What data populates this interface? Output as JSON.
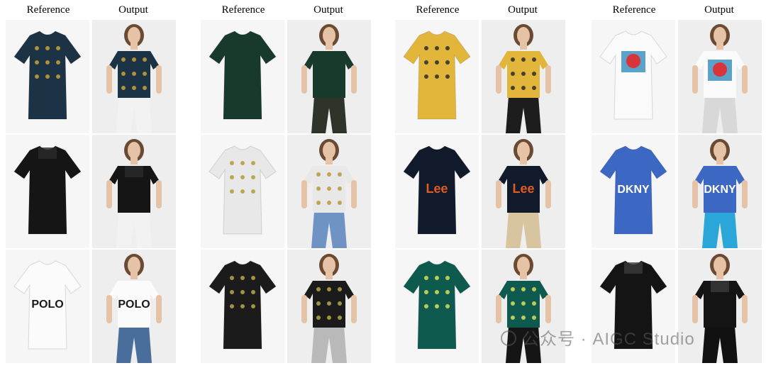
{
  "groups": [
    {
      "reference_header": "Reference",
      "output_header": "Output",
      "rows": [
        {
          "garment": "floral-blouse",
          "color": "#1b3345",
          "accent": "#c9a23a",
          "output_bottom": "#f2f2f2"
        },
        {
          "garment": "lace-top",
          "color": "#151515",
          "accent": "#2a2a2a",
          "output_bottom": "#f2f2f2"
        },
        {
          "garment": "polo-tee",
          "color": "#fbfbfb",
          "accent": "#1a1a1a",
          "print": "POLO",
          "output_bottom": "#4a6e9c"
        }
      ]
    },
    {
      "reference_header": "Reference",
      "output_header": "Output",
      "rows": [
        {
          "garment": "bodysuit",
          "color": "#173a2c",
          "accent": "#173a2c",
          "output_bottom": "#2e3429"
        },
        {
          "garment": "graphic-tee",
          "color": "#e8e8e8",
          "accent": "#b79a3b",
          "output_bottom": "#6f93c4"
        },
        {
          "garment": "floral-tee",
          "color": "#1b1b1b",
          "accent": "#b8a948",
          "output_bottom": "#b9b9b9"
        }
      ]
    },
    {
      "reference_header": "Reference",
      "output_header": "Output",
      "rows": [
        {
          "garment": "yellow-floral",
          "color": "#e2b63a",
          "accent": "#2c2c2c",
          "output_bottom": "#1d1d1d"
        },
        {
          "garment": "lee-tee",
          "color": "#111a2b",
          "accent": "#e25a22",
          "print": "Lee",
          "output_bottom": "#d9c4a0"
        },
        {
          "garment": "green-blouse",
          "color": "#0f5a4f",
          "accent": "#d8e05a",
          "output_bottom": "#151515"
        }
      ]
    },
    {
      "reference_header": "Reference",
      "output_header": "Output",
      "rows": [
        {
          "garment": "rose-tee",
          "color": "#fafafa",
          "accent": "#d8343a",
          "output_bottom": "#d8d8d8"
        },
        {
          "garment": "dkny-tee",
          "color": "#3c67c2",
          "accent": "#ffffff",
          "print": "DKNY",
          "output_bottom": "#2aa7d8"
        },
        {
          "garment": "lace-sweater",
          "color": "#141414",
          "accent": "#3a3a3a",
          "output_bottom": "#111111"
        }
      ]
    }
  ],
  "watermark": "公众号 · AIGC Studio",
  "skin": "#e6c3a6",
  "hair": "#6a4a33"
}
